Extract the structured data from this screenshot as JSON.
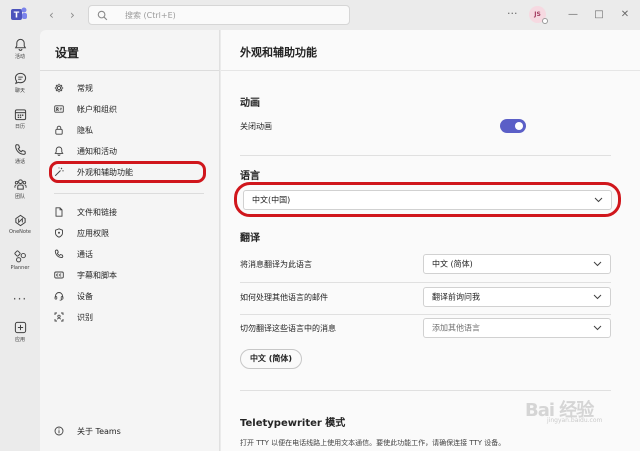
{
  "colors": {
    "accent": "#5b5fc7",
    "highlight": "#d0161c",
    "background": "#ebebeb",
    "panel": "#f5f5f5",
    "content": "#fafafa"
  },
  "titlebar": {
    "search_placeholder": "搜索 (Ctrl+E)",
    "more_label": "···",
    "avatar_initials": "JS",
    "minimize": "—",
    "maximize": "□",
    "close": "✕"
  },
  "rail": {
    "items": [
      {
        "label": "活动",
        "icon": "bell-icon"
      },
      {
        "label": "聊天",
        "icon": "chat-icon"
      },
      {
        "label": "日历",
        "icon": "calendar-icon"
      },
      {
        "label": "通话",
        "icon": "phone-icon"
      },
      {
        "label": "团队",
        "icon": "teams-icon"
      },
      {
        "label": "OneNote",
        "icon": "onenote-icon"
      },
      {
        "label": "Planner",
        "icon": "planner-icon"
      },
      {
        "label": "应用",
        "icon": "apps-icon"
      }
    ],
    "more_label": "···"
  },
  "settings": {
    "title": "设置",
    "items": [
      {
        "label": "常规",
        "icon": "gear-icon"
      },
      {
        "label": "帐户和组织",
        "icon": "id-card-icon"
      },
      {
        "label": "隐私",
        "icon": "lock-icon"
      },
      {
        "label": "通知和活动",
        "icon": "bell-icon"
      },
      {
        "label": "外观和辅助功能",
        "icon": "magic-wand-icon"
      },
      {
        "label": "文件和链接",
        "icon": "document-icon"
      },
      {
        "label": "应用权限",
        "icon": "shield-icon"
      },
      {
        "label": "通话",
        "icon": "phone-icon"
      },
      {
        "label": "字幕和脚本",
        "icon": "captions-icon"
      },
      {
        "label": "设备",
        "icon": "headset-icon"
      },
      {
        "label": "识别",
        "icon": "recognition-icon"
      }
    ],
    "about_label": "关于 Teams"
  },
  "main": {
    "title": "外观和辅助功能",
    "animation": {
      "heading": "动画",
      "disable_label": "关闭动画",
      "toggle_on": true
    },
    "language": {
      "heading": "语言",
      "selected": "中文(中国)"
    },
    "translation": {
      "heading": "翻译",
      "rows": [
        {
          "label": "将消息翻译为此语言",
          "value": "中文 (简体)",
          "is_placeholder": false
        },
        {
          "label": "如何处理其他语言的邮件",
          "value": "翻译前询问我",
          "is_placeholder": false
        },
        {
          "label": "切勿翻译这些语言中的消息",
          "value": "添加其他语言",
          "is_placeholder": true
        }
      ],
      "chip": "中文 (简体)"
    },
    "tty": {
      "heading": "Teletypewriter 模式",
      "description": "打开 TTY 以便在电话线路上使用文本通信。要使此功能工作，请确保连接 TTY 设备。"
    }
  },
  "watermark": {
    "text": "Bai 经验",
    "sub": "jingyan.baidu.com"
  }
}
